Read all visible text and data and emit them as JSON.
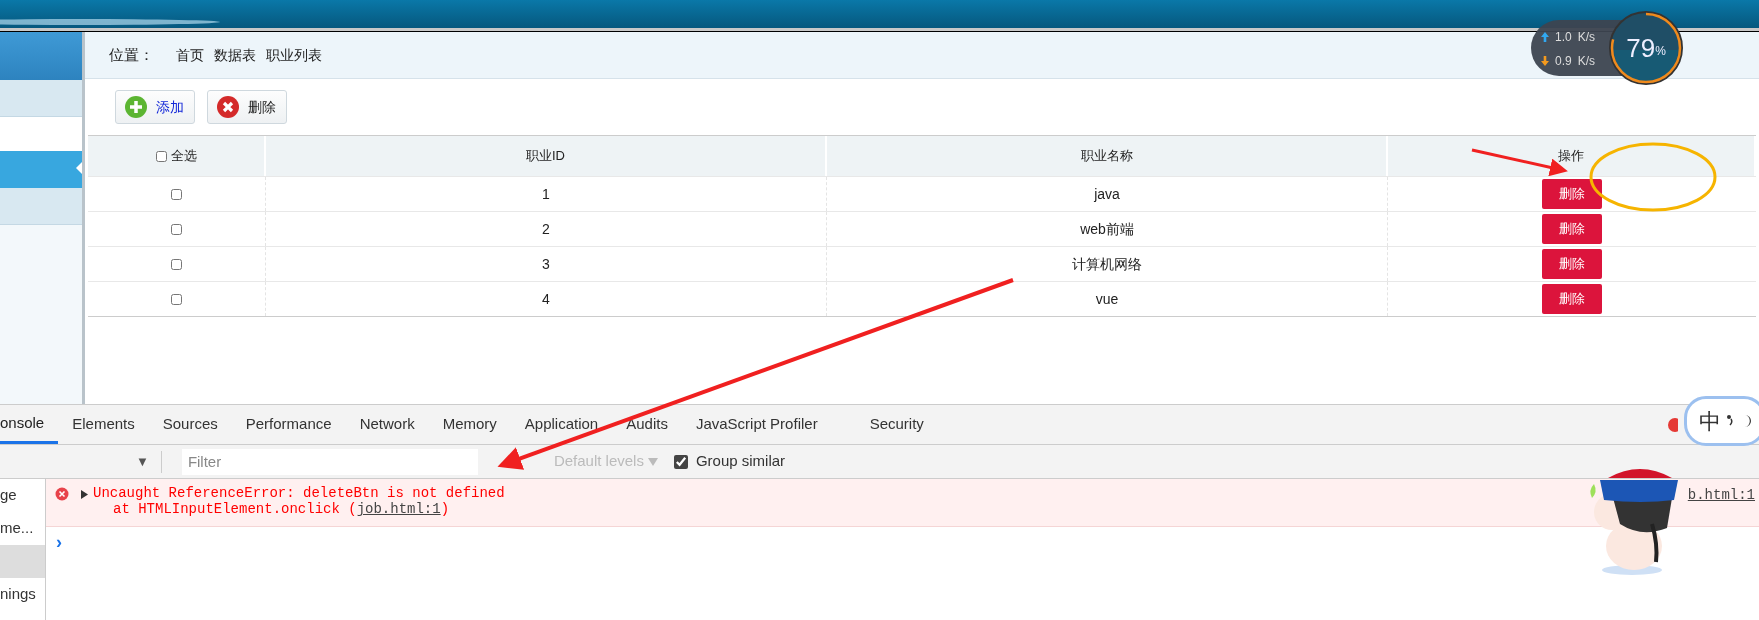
{
  "breadcrumb": {
    "label": "位置：",
    "items": [
      "首页",
      "数据表",
      "职业列表"
    ]
  },
  "toolbar": [
    {
      "kind": "add",
      "label": "添加"
    },
    {
      "kind": "delete",
      "label": "删除"
    }
  ],
  "sidebar": {
    "items": [
      {
        "kind": "header",
        "selected": false
      },
      {
        "kind": "item",
        "selected": false
      },
      {
        "kind": "blank",
        "selected": false
      },
      {
        "kind": "item",
        "selected": true
      },
      {
        "kind": "item",
        "selected": false
      }
    ]
  },
  "table": {
    "select_all": {
      "label": "全选",
      "checked": false
    },
    "columns": [
      "职业ID",
      "职业名称",
      "操作"
    ],
    "rows": [
      {
        "checked": false,
        "id": "1",
        "name": "java",
        "action": "删除"
      },
      {
        "checked": false,
        "id": "2",
        "name": "web前端",
        "action": "删除"
      },
      {
        "checked": false,
        "id": "3",
        "name": "计算机网络",
        "action": "删除"
      },
      {
        "checked": false,
        "id": "4",
        "name": "vue",
        "action": "删除"
      }
    ]
  },
  "speed_widget": {
    "upload": "1.0",
    "upload_unit": "K/s",
    "download": "0.9",
    "download_unit": "K/s",
    "percent": "79",
    "percent_sign": "%"
  },
  "devtools": {
    "tabs": [
      {
        "label": "onsole",
        "selected": true
      },
      {
        "label": "Elements",
        "selected": false
      },
      {
        "label": "Sources",
        "selected": false
      },
      {
        "label": "Performance",
        "selected": false
      },
      {
        "label": "Network",
        "selected": false
      },
      {
        "label": "Memory",
        "selected": false
      },
      {
        "label": "Application",
        "selected": false
      },
      {
        "label": "Audits",
        "selected": false
      },
      {
        "label": "JavaScript Profiler",
        "selected": false
      },
      {
        "label": "Security",
        "selected": false
      }
    ],
    "filter": {
      "caret": "▼",
      "placeholder": "Filter",
      "levels": "Default levels",
      "levels_disabled": true,
      "group_similar": {
        "label": "Group similar",
        "checked": true
      }
    },
    "sidebar": [
      {
        "label": "ge",
        "selected": false
      },
      {
        "label": "me...",
        "selected": false
      },
      {
        "selected": true
      },
      {
        "label": "nings",
        "selected": false
      }
    ],
    "error": {
      "line1": "Uncaught ReferenceError: deleteBtn is not defined",
      "line2": "at HTMLInputElement.onclick (",
      "link": "job.html:1",
      "line2_end": ")",
      "source": "b.html:1"
    },
    "prompt": "›"
  },
  "ime_bubble": {
    "label": "中"
  }
}
